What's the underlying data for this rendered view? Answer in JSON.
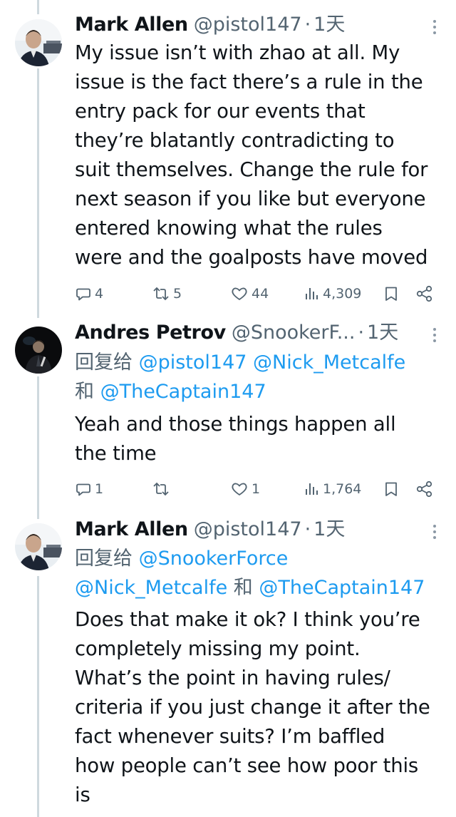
{
  "tweets": [
    {
      "name": "Mark Allen",
      "handle": "@pistol147",
      "dot": "·",
      "time": "1天",
      "lines": [
        "My issue isn’t with zhao at all. My",
        "issue is the fact there’s a rule in the",
        "entry pack for our events that",
        "they’re blatantly contradicting to",
        "suit themselves. Change the rule for",
        "next season if you like but everyone",
        "entered knowing what the rules",
        "were and the goalposts have moved"
      ],
      "replies": "4",
      "retweets": "5",
      "likes": "44",
      "views": "4,309",
      "icons": [
        "reply-icon",
        "retweet-icon",
        "like-icon",
        "views-icon",
        "bookmark-icon",
        "share-icon",
        "more-icon"
      ]
    },
    {
      "name": "Andres Petrov",
      "handle": "@SnookerF...",
      "dot": "·",
      "time": "1天",
      "reply_prefix": "回复给",
      "reply_mention_1": "@pistol147",
      "reply_mention_2": "@Nick_Metcalfe",
      "reply_and": "和",
      "reply_mention_3": "@TheCaptain147",
      "lines": [
        "Yeah and those things happen all",
        "the time"
      ],
      "replies": "1",
      "retweets": "",
      "likes": "1",
      "views": "1,764"
    },
    {
      "name": "Mark Allen",
      "handle": "@pistol147",
      "dot": "·",
      "time": "1天",
      "reply_prefix": "回复给",
      "reply_mention_1": "@SnookerForce",
      "reply_mention_2": "@Nick_Metcalfe",
      "reply_and": "和",
      "reply_mention_3": "@TheCaptain147",
      "lines": [
        "Does that make it ok? I think you’re",
        "completely missing my point.",
        "What’s the point in having rules/",
        "criteria if you just change it after the",
        "fact whenever suits? I’m baffled",
        "how people can’t see how poor this",
        "is"
      ]
    }
  ],
  "colors": {
    "text": "#0f1419",
    "secondary": "#536471",
    "link": "#1d9bf0",
    "thread_line": "#cfd9de"
  }
}
